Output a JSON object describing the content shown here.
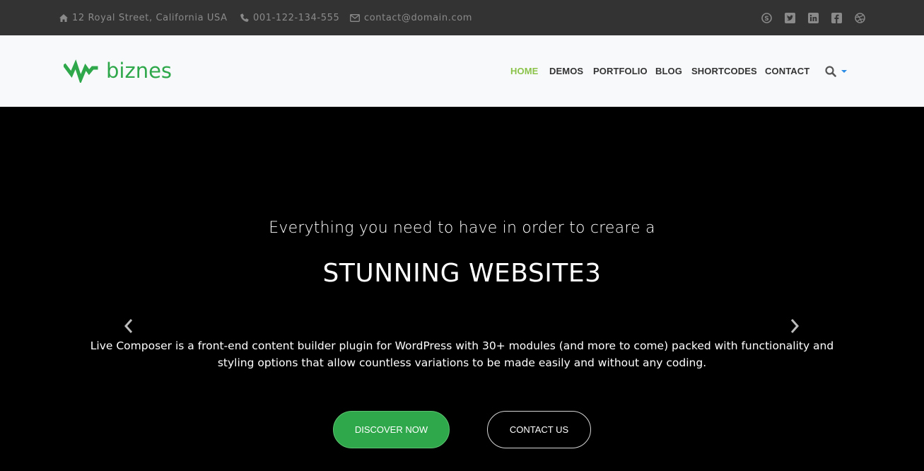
{
  "topbar": {
    "address": "12 Royal Street, California USA",
    "phone": "001-122-134-555",
    "email": "contact@domain.com",
    "social": [
      "skype-icon",
      "twitter-icon",
      "linkedin-icon",
      "facebook-icon",
      "dribbble-icon"
    ]
  },
  "header": {
    "logo_text": "biznes",
    "nav": [
      {
        "label": "HOME",
        "active": true
      },
      {
        "label": "DEMOS"
      },
      {
        "label": "PORTFOLIO"
      },
      {
        "label": "BLOG"
      },
      {
        "label": "SHORTCODES"
      },
      {
        "label": "CONTACT"
      }
    ]
  },
  "hero": {
    "pretitle": "Everything you need to have in order to creare a",
    "title": "STUNNING WEBSITE3",
    "description": "Live Composer is a front-end content builder plugin for WordPress with 30+ modules (and more to come) packed with functionality and styling options that allow countless variations to be made easily and without any coding.",
    "primary_button": "DISCOVER NOW",
    "secondary_button": "CONTACT US"
  },
  "colors": {
    "accent": "#2ea84a",
    "nav_active": "#8bc34a",
    "topbar_bg": "#333333",
    "header_bg": "#f8f9fb",
    "hero_bg": "#000000",
    "search_caret": "#2b8ce6"
  }
}
